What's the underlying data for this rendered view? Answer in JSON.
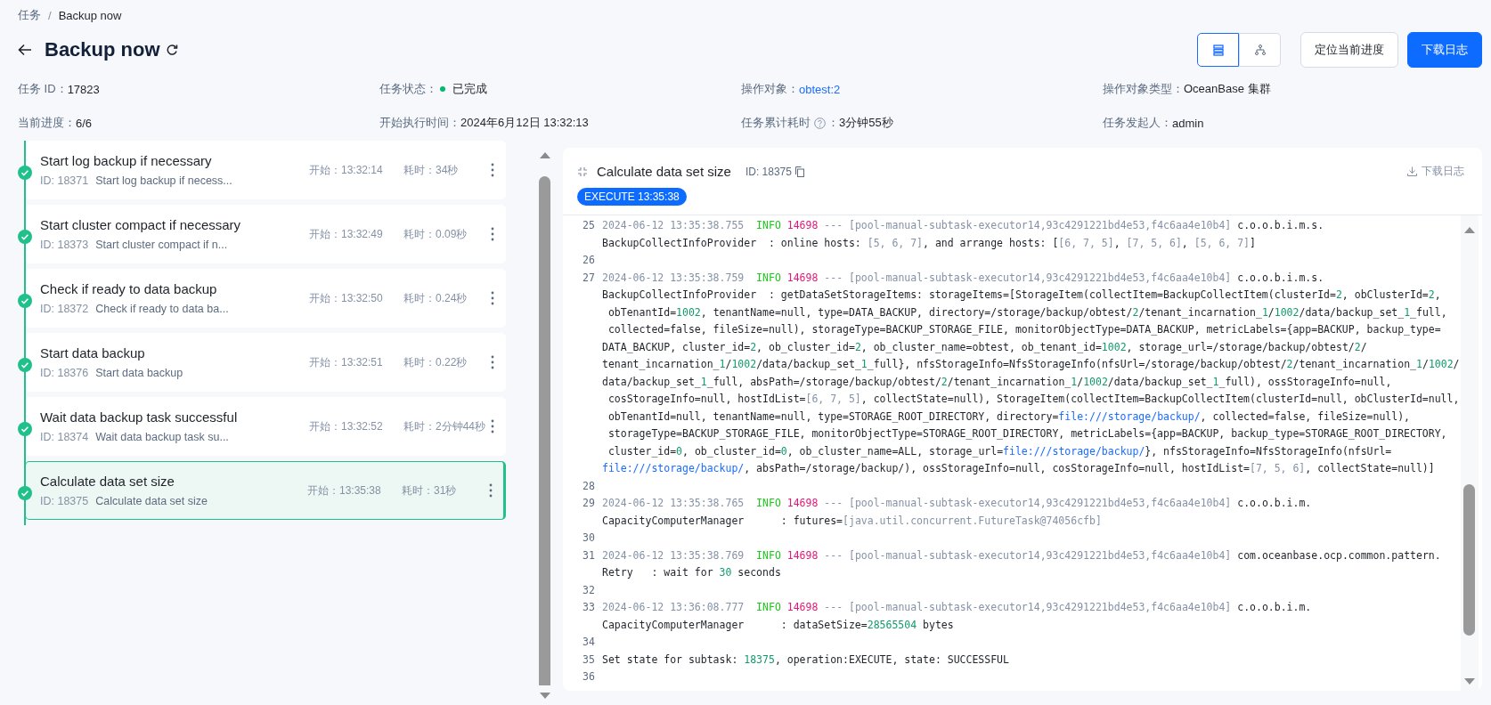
{
  "breadcrumb": [
    {
      "label": "任务",
      "kind": "link"
    },
    {
      "label": "/",
      "kind": "separator"
    },
    {
      "label": "Backup now",
      "kind": "current"
    }
  ],
  "title": "Backup now",
  "view_toggle": [
    {
      "kind": "list",
      "selected": true
    },
    {
      "kind": "tree",
      "selected": false
    }
  ],
  "buttons": [
    {
      "label": "定位当前进度",
      "kind": "default"
    },
    {
      "label": "下载日志",
      "kind": "primary"
    }
  ],
  "info": [
    {
      "label": "任务 ID：",
      "value": "17823",
      "kind": "text"
    },
    {
      "label": "任务状态：",
      "value": "已完成",
      "kind": "status",
      "color": "#00b96b"
    },
    {
      "label": "操作对象：",
      "value": "obtest:2",
      "kind": "link"
    },
    {
      "label": "操作对象类型：",
      "value": "OceanBase 集群",
      "kind": "text"
    },
    {
      "label": "当前进度：",
      "value": "6/6",
      "kind": "text"
    },
    {
      "label": "开始执行时间：",
      "value": "2024年6月12日 13:32:13",
      "kind": "text"
    },
    {
      "label": "任务累计耗时",
      "suffix": "：",
      "value": "3分钟55秒",
      "kind": "help"
    },
    {
      "label": "任务发起人：",
      "value": "admin",
      "kind": "text"
    }
  ],
  "tasks": [
    {
      "title": "Start log backup if necessary",
      "id": "ID: 18371",
      "desc": "Start log backup if necess...",
      "start_label": "开始：",
      "start": "13:32:14",
      "duration_label": "耗时：",
      "duration": "34秒",
      "done": true,
      "selected": false
    },
    {
      "title": "Start cluster compact if necessary",
      "id": "ID: 18373",
      "desc": "Start cluster compact if n...",
      "start_label": "开始：",
      "start": "13:32:49",
      "duration_label": "耗时：",
      "duration": "0.09秒",
      "done": true,
      "selected": false
    },
    {
      "title": "Check if ready to data backup",
      "id": "ID: 18372",
      "desc": "Check if ready to data ba...",
      "start_label": "开始：",
      "start": "13:32:50",
      "duration_label": "耗时：",
      "duration": "0.24秒",
      "done": true,
      "selected": false
    },
    {
      "title": "Start data backup",
      "id": "ID: 18376",
      "desc": "Start data backup",
      "start_label": "开始：",
      "start": "13:32:51",
      "duration_label": "耗时：",
      "duration": "0.22秒",
      "done": true,
      "selected": false
    },
    {
      "title": "Wait data backup task successful",
      "id": "ID: 18374",
      "desc": "Wait data backup task su...",
      "start_label": "开始：",
      "start": "13:32:52",
      "duration_label": "耗时：",
      "duration": "2分钟44秒",
      "done": true,
      "selected": false
    },
    {
      "title": "Calculate data set size",
      "id": "ID: 18375",
      "desc": "Calculate data set size",
      "start_label": "开始：",
      "start": "13:35:38",
      "duration_label": "耗时：",
      "duration": "31秒",
      "done": true,
      "selected": true
    }
  ],
  "log_panel": {
    "title": "Calculate data set size",
    "id": "ID: 18375",
    "download": "下载日志",
    "tag": "EXECUTE 13:35:38",
    "entries": [
      {
        "n": "25",
        "lines": [
          "2024-06-12 13:35:38.755  INFO 14698 --- [pool-manual-subtask-executor14,93c4291221bd4e53,f4c6aa4e10b4] c.o.o.b.i.m.s.",
          "BackupCollectInfoProvider  : online hosts: [5, 6, 7], and arrange hosts: [[6, 7, 5], [7, 5, 6], [5, 6, 7]]"
        ]
      },
      {
        "n": "26"
      },
      {
        "n": "27",
        "lines": [
          "2024-06-12 13:35:38.759  INFO 14698 --- [pool-manual-subtask-executor14,93c4291221bd4e53,f4c6aa4e10b4] c.o.o.b.i.m.s.",
          "BackupCollectInfoProvider  : getDataSetStorageItems: storageItems=[StorageItem(collectItem=BackupCollectItem(clusterId=2, obClusterId=2,",
          " obTenantId=1002, tenantName=null, type=DATA_BACKUP, directory=/storage/backup/obtest/2/tenant_incarnation_1/1002/data/backup_set_1_full,",
          " collected=false, fileSize=null), storageType=BACKUP_STORAGE_FILE, monitorObjectType=DATA_BACKUP, metricLabels={app=BACKUP, backup_type=",
          "DATA_BACKUP, cluster_id=2, ob_cluster_id=2, ob_cluster_name=obtest, ob_tenant_id=1002, storage_url=/storage/backup/obtest/2/",
          "tenant_incarnation_1/1002/data/backup_set_1_full}, nfsStorageInfo=NfsStorageInfo(nfsUrl=/storage/backup/obtest/2/tenant_incarnation_1/1002/",
          "data/backup_set_1_full, absPath=/storage/backup/obtest/2/tenant_incarnation_1/1002/data/backup_set_1_full), ossStorageInfo=null,",
          " cosStorageInfo=null, hostIdList=[6, 7, 5], collectState=null), StorageItem(collectItem=BackupCollectItem(clusterId=null, obClusterId=null,",
          " obTenantId=null, tenantName=null, type=STORAGE_ROOT_DIRECTORY, directory=file:///storage/backup/, collected=false, fileSize=null),",
          " storageType=BACKUP_STORAGE_FILE, monitorObjectType=STORAGE_ROOT_DIRECTORY, metricLabels={app=BACKUP, backup_type=STORAGE_ROOT_DIRECTORY,",
          " cluster_id=0, ob_cluster_id=0, ob_cluster_name=ALL, storage_url=file:///storage/backup/}, nfsStorageInfo=NfsStorageInfo(nfsUrl=",
          "file:///storage/backup/, absPath=/storage/backup/), ossStorageInfo=null, cosStorageInfo=null, hostIdList=[7, 5, 6], collectState=null)]"
        ]
      },
      {
        "n": "28"
      },
      {
        "n": "29",
        "lines": [
          "2024-06-12 13:35:38.765  INFO 14698 --- [pool-manual-subtask-executor14,93c4291221bd4e53,f4c6aa4e10b4] c.o.o.b.i.m.",
          "CapacityComputerManager      : futures=[java.util.concurrent.FutureTask@74056cfb]"
        ]
      },
      {
        "n": "30"
      },
      {
        "n": "31",
        "lines": [
          "2024-06-12 13:35:38.769  INFO 14698 --- [pool-manual-subtask-executor14,93c4291221bd4e53,f4c6aa4e10b4] com.oceanbase.ocp.common.pattern.",
          "Retry   : wait for 30 seconds"
        ]
      },
      {
        "n": "32"
      },
      {
        "n": "33",
        "lines": [
          "2024-06-12 13:36:08.777  INFO 14698 --- [pool-manual-subtask-executor14,93c4291221bd4e53,f4c6aa4e10b4] c.o.o.b.i.m.",
          "CapacityComputerManager      : dataSetSize=28565504 bytes"
        ]
      },
      {
        "n": "34"
      },
      {
        "n": "35",
        "lines": [
          "Set state for subtask: 18375, operation:EXECUTE, state: SUCCESSFUL"
        ]
      },
      {
        "n": "36"
      }
    ]
  }
}
